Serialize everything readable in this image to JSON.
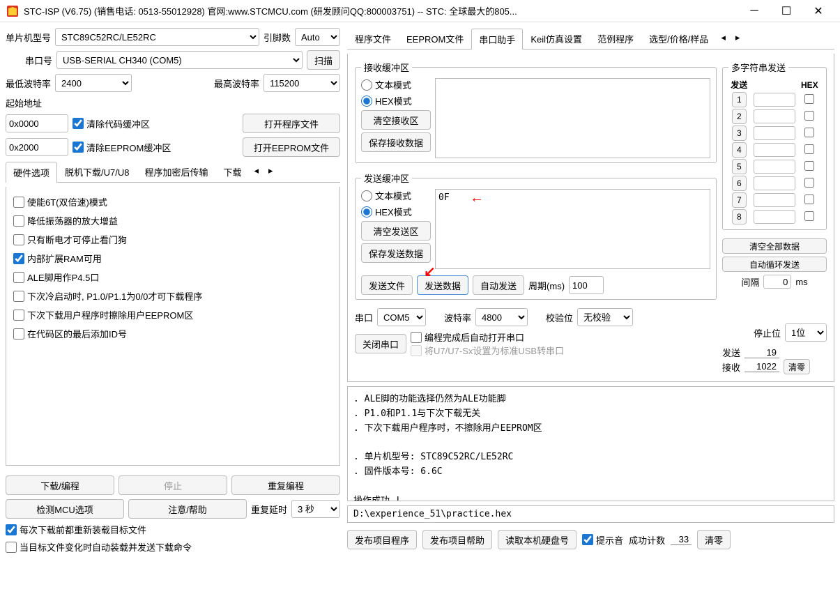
{
  "window": {
    "title": "STC-ISP (V6.75) (销售电话: 0513-55012928) 官网:www.STCMCU.com  (研发顾问QQ:800003751)  -- STC: 全球最大的805..."
  },
  "left": {
    "chip_label": "单片机型号",
    "chip_value": "STC89C52RC/LE52RC",
    "pin_label": "引脚数",
    "pin_value": "Auto",
    "port_label": "串口号",
    "port_value": "USB-SERIAL CH340 (COM5)",
    "scan_btn": "扫描",
    "baud_min_label": "最低波特率",
    "baud_min_value": "2400",
    "baud_max_label": "最高波特率",
    "baud_max_value": "115200",
    "start_addr_label": "起始地址",
    "addr1": "0x0000",
    "clear_code": "清除代码缓冲区",
    "open_prog": "打开程序文件",
    "addr2": "0x2000",
    "clear_eeprom": "清除EEPROM缓冲区",
    "open_eeprom": "打开EEPROM文件",
    "tabs": [
      "硬件选项",
      "脱机下载/U7/U8",
      "程序加密后传输",
      "下载"
    ],
    "hw_opts": [
      {
        "label": "使能6T(双倍速)模式",
        "checked": false
      },
      {
        "label": "降低振荡器的放大增益",
        "checked": false
      },
      {
        "label": "只有断电才可停止看门狗",
        "checked": false
      },
      {
        "label": "内部扩展RAM可用",
        "checked": true
      },
      {
        "label": "ALE脚用作P4.5口",
        "checked": false
      },
      {
        "label": "下次冷启动时, P1.0/P1.1为0/0才可下载程序",
        "checked": false
      },
      {
        "label": "下次下载用户程序时擦除用户EEPROM区",
        "checked": false
      },
      {
        "label": "在代码区的最后添加ID号",
        "checked": false
      }
    ],
    "download_btn": "下载/编程",
    "stop_btn": "停止",
    "repeat_btn": "重复编程",
    "check_mcu": "检测MCU选项",
    "help_btn": "注意/帮助",
    "delay_label": "重复延时",
    "delay_value": "3 秒",
    "chk_reload": "每次下载前都重新装载目标文件",
    "chk_autoload": "当目标文件变化时自动装载并发送下载命令"
  },
  "right": {
    "tabs": [
      "程序文件",
      "EEPROM文件",
      "串口助手",
      "Keil仿真设置",
      "范例程序",
      "选型/价格/样品"
    ],
    "recv_legend": "接收缓冲区",
    "text_mode": "文本模式",
    "hex_mode": "HEX模式",
    "clear_recv": "清空接收区",
    "save_recv": "保存接收数据",
    "send_legend": "发送缓冲区",
    "send_text": "0F",
    "clear_send": "清空发送区",
    "save_send": "保存发送数据",
    "send_file": "发送文件",
    "send_data": "发送数据",
    "auto_send": "自动发送",
    "period_label": "周期(ms)",
    "period_value": "100",
    "multi_legend": "多字符串发送",
    "multi_send_hdr": "发送",
    "multi_hex_hdr": "HEX",
    "multi_rows": [
      "1",
      "2",
      "3",
      "4",
      "5",
      "6",
      "7",
      "8"
    ],
    "multi_clear": "清空全部数据",
    "multi_loop": "自动循环发送",
    "interval_label": "间隔",
    "interval_value": "0",
    "interval_unit": "ms",
    "serial_label": "串口",
    "serial_value": "COM5",
    "baud_label": "波特率",
    "baud_value": "4800",
    "parity_label": "校验位",
    "parity_value": "无校验",
    "stop_label": "停止位",
    "stop_value": "1位",
    "close_port": "关闭串口",
    "chk_after_prog": "编程完成后自动打开串口",
    "chk_u7": "将U7/U7-Sx设置为标准USB转串口",
    "stat_send_label": "发送",
    "stat_send_val": "19",
    "stat_recv_label": "接收",
    "stat_recv_val": "1022",
    "clear_stat": "清零",
    "log_lines": [
      "  . ALE脚的功能选择仍然为ALE功能脚",
      "  . P1.0和P1.1与下次下载无关",
      "  . 下次下载用户程序时，不擦除用户EEPROM区",
      "",
      "  . 单片机型号: STC89C52RC/LE52RC",
      "  . 固件版本号: 6.6C",
      "",
      "操作成功 !"
    ],
    "filepath": "D:\\experience_51\\practice.hex",
    "pub_prog": "发布项目程序",
    "pub_help": "发布项目帮助",
    "read_disk": "读取本机硬盘号",
    "beep": "提示音",
    "succ_label": "成功计数",
    "succ_val": "33",
    "clear_succ": "清零"
  }
}
